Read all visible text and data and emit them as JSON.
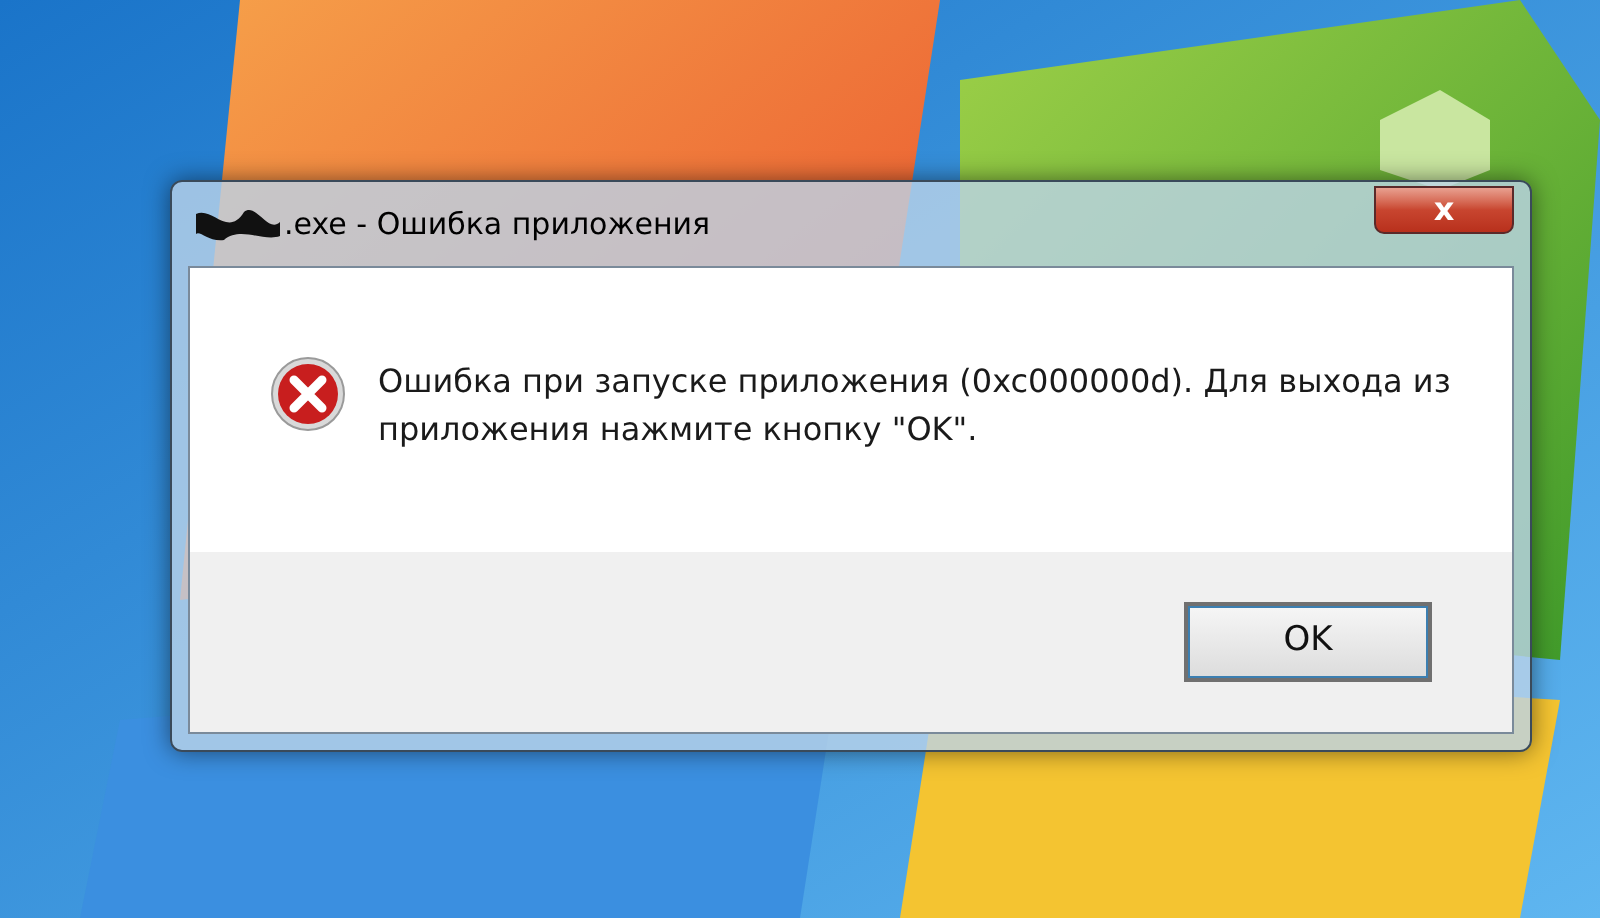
{
  "window": {
    "title": ".exe - Ошибка приложения",
    "title_redacted": true,
    "close_label": "x"
  },
  "message": {
    "text": "Ошибка при запуске приложения (0xc000000d). Для выхода из приложения нажмите кнопку \"OK\"."
  },
  "buttons": [
    {
      "label": "OK",
      "default": true
    }
  ]
}
